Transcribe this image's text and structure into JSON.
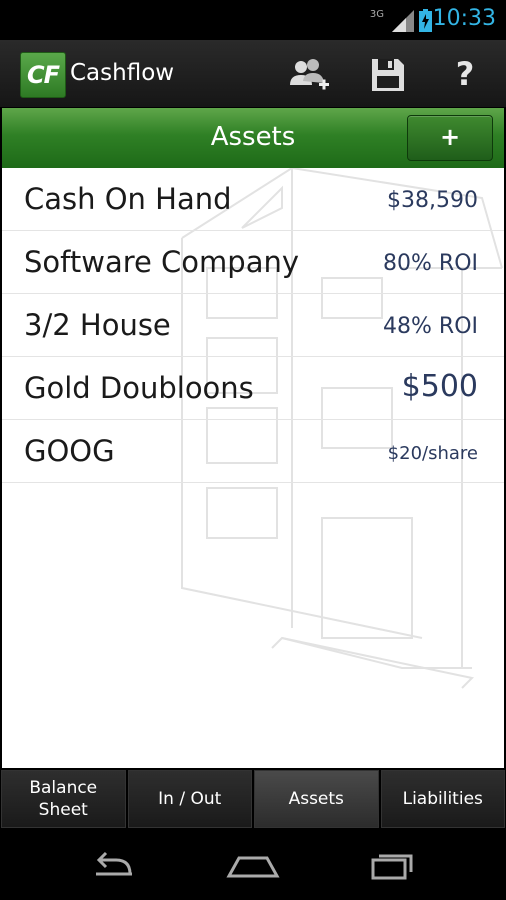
{
  "status_bar": {
    "network": "3G",
    "time": "10:33"
  },
  "app": {
    "logo_text": "CF",
    "title": "Cashflow"
  },
  "section": {
    "title": "Assets",
    "add_label": "+"
  },
  "assets": [
    {
      "name": "Cash On Hand",
      "value": "$38,590"
    },
    {
      "name": "Software Company",
      "value": "80% ROI"
    },
    {
      "name": "3/2 House",
      "value": "48% ROI"
    },
    {
      "name": "Gold Doubloons",
      "value": "$500"
    },
    {
      "name": "GOOG",
      "value": "$20/share"
    }
  ],
  "tabs": [
    {
      "label": "Balance\nSheet",
      "selected": false
    },
    {
      "label": "In / Out",
      "selected": false
    },
    {
      "label": "Assets",
      "selected": true
    },
    {
      "label": "Liabilities",
      "selected": false
    }
  ],
  "icons": {
    "add_players": "add-players-icon",
    "save": "save-icon",
    "help": "?"
  },
  "colors": {
    "accent_green": "#2f8025",
    "status_blue": "#33b5e5",
    "value_text": "#2b3a5e"
  }
}
